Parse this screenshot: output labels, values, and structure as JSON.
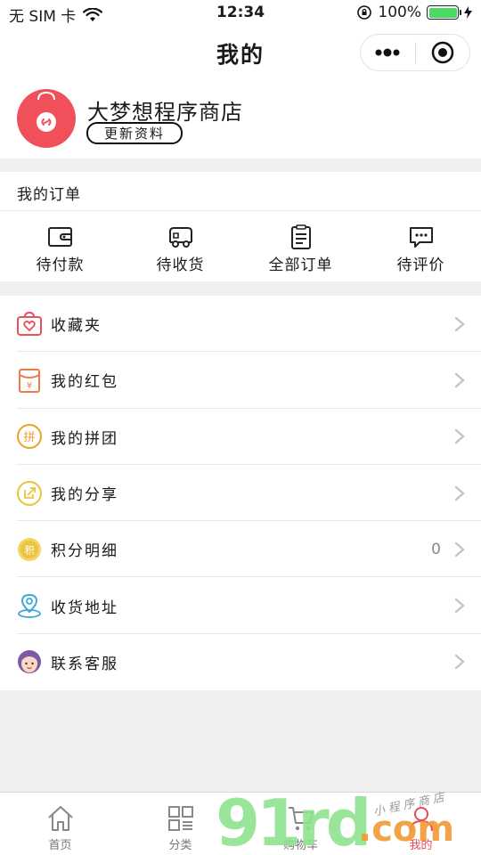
{
  "status_bar": {
    "carrier": "无 SIM 卡",
    "time": "12:34",
    "battery": "100%",
    "battery_level": 1.0
  },
  "nav": {
    "title": "我的",
    "icons": [
      "more-dots-icon",
      "close-target-icon"
    ]
  },
  "profile": {
    "store_name": "大梦想程序商店",
    "edit_label": "更新资料",
    "avatar_color": "#f0505a"
  },
  "orders": {
    "title": "我的订单",
    "items": [
      {
        "label": "待付款",
        "icon": "wallet-icon"
      },
      {
        "label": "待收货",
        "icon": "truck-icon"
      },
      {
        "label": "全部订单",
        "icon": "clipboard-icon"
      },
      {
        "label": "待评价",
        "icon": "comment-icon"
      }
    ]
  },
  "menu": {
    "items": [
      {
        "label": "收藏夹",
        "icon": "heart-bag-icon",
        "color": "#e8505b"
      },
      {
        "label": "我的红包",
        "icon": "red-envelope-icon",
        "color": "#f07a4a"
      },
      {
        "label": "我的拼团",
        "icon": "group-buy-icon",
        "color": "#e9a32a"
      },
      {
        "label": "我的分享",
        "icon": "share-icon",
        "color": "#e9c43a"
      },
      {
        "label": "积分明细",
        "icon": "points-icon",
        "color": "#eac640",
        "value": "0"
      },
      {
        "label": "收货地址",
        "icon": "location-pin-icon",
        "color": "#3fa7d6"
      },
      {
        "label": "联系客服",
        "icon": "customer-service-icon",
        "color": "#7a5aa8"
      }
    ]
  },
  "tabs": [
    {
      "label": "首页",
      "icon": "home-icon"
    },
    {
      "label": "分类",
      "icon": "category-icon"
    },
    {
      "label": "购物车",
      "icon": "cart-icon"
    },
    {
      "label": "我的",
      "icon": "profile-icon",
      "active": true
    }
  ],
  "watermark": {
    "number": "91rd",
    "domain": ".com",
    "text": "小程序商店"
  },
  "colors": {
    "accent": "#e84b55",
    "background": "#efefef"
  }
}
